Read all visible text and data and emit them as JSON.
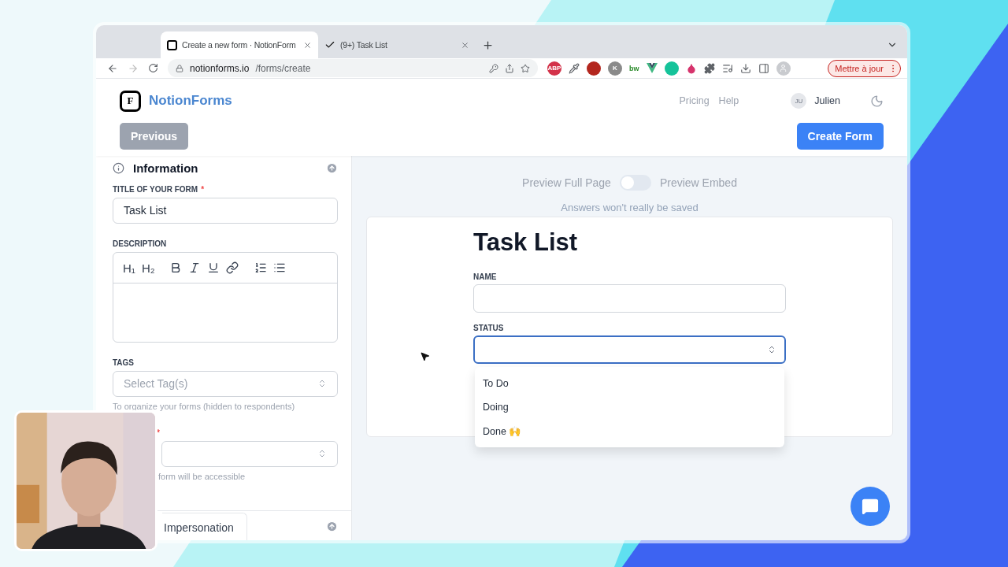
{
  "browser": {
    "tabs": [
      {
        "title": "Create a new form · NotionForm",
        "selected": true,
        "kind": "brand"
      },
      {
        "title": "(9+) Task List",
        "selected": false,
        "kind": "check"
      }
    ],
    "address": {
      "domain": "notionforms.io",
      "path": "/forms/create"
    },
    "extensions": [
      {
        "kind": "abp",
        "label": "ABP"
      },
      {
        "kind": "dropper"
      },
      {
        "kind": "s"
      },
      {
        "kind": "k",
        "label": "K"
      },
      {
        "kind": "bw",
        "label": "bw"
      },
      {
        "kind": "vue"
      },
      {
        "kind": "g"
      },
      {
        "kind": "drop"
      },
      {
        "kind": "puzzle"
      },
      {
        "kind": "playlist"
      },
      {
        "kind": "download"
      },
      {
        "kind": "sidebar"
      },
      {
        "kind": "profile"
      }
    ],
    "update_button": "Mettre à jour"
  },
  "header": {
    "logo_letter": "F",
    "brand": "NotionForms",
    "nav": [
      "Pricing",
      "Help"
    ],
    "user": {
      "initials": "JU",
      "name": "Julien"
    },
    "previous_button": "Previous",
    "create_button": "Create Form"
  },
  "sidebar": {
    "section": "Information",
    "title_field": {
      "label": "TITLE OF YOUR FORM",
      "required_mark": "*",
      "value": "Task List"
    },
    "description": {
      "label": "DESCRIPTION",
      "tools": [
        {
          "kind": "heading",
          "label": "H₁"
        },
        {
          "kind": "heading",
          "label": "H₂"
        },
        {
          "kind": "bold"
        },
        {
          "kind": "italic"
        },
        {
          "kind": "underline"
        },
        {
          "kind": "link"
        },
        {
          "kind": "ordered"
        },
        {
          "kind": "bullet"
        }
      ]
    },
    "tags": {
      "label": "TAGS",
      "placeholder": "Select Tag(s)",
      "help": "To organize your forms (hidden to respondents)"
    },
    "access": {
      "required_mark": "*",
      "help": "form will be accessible"
    },
    "next_section": "Impersonation"
  },
  "preview": {
    "full_page_label": "Preview Full Page",
    "embed_label": "Preview Embed",
    "embed_on": false,
    "note": "Answers won't really be saved",
    "form": {
      "title": "Task List",
      "fields": [
        {
          "label": "NAME",
          "kind": "text",
          "focused": false
        },
        {
          "label": "STATUS",
          "kind": "select",
          "focused": true
        }
      ],
      "options": [
        "To Do",
        "Doing",
        "Done 🙌"
      ]
    }
  }
}
